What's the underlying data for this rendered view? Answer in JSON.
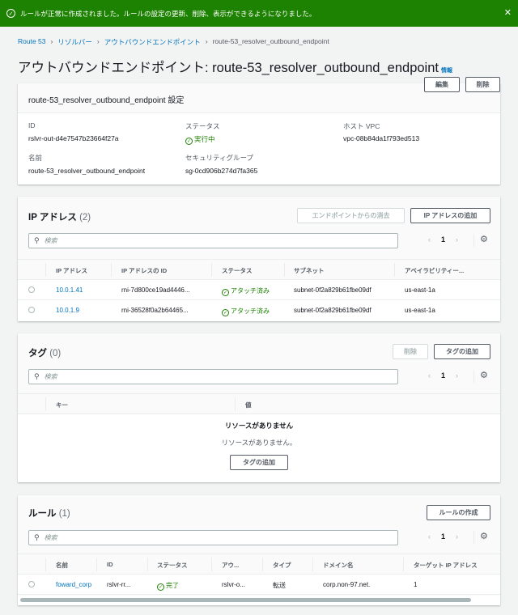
{
  "banner": {
    "message": "ルールが正常に作成されました。ルールの設定の更新、削除、表示ができるようになりました。",
    "success_color": "#1d8102"
  },
  "breadcrumb": [
    "Route 53",
    "リゾルバー",
    "アウトバウンドエンドポイント",
    "route-53_resolver_outbound_endpoint"
  ],
  "page": {
    "title": "アウトバウンドエンドポイント: route-53_resolver_outbound_endpoint",
    "info": "情報",
    "edit": "編集",
    "delete": "削除"
  },
  "settings": {
    "title": "route-53_resolver_outbound_endpoint 設定",
    "id_label": "ID",
    "id": "rslvr-out-d4e7547b23664f27a",
    "status_label": "ステータス",
    "status": "実行中",
    "vpc_label": "ホスト VPC",
    "vpc": "vpc-08b84da1f793ed513",
    "name_label": "名前",
    "name": "route-53_resolver_outbound_endpoint",
    "sg_label": "セキュリティグループ",
    "sg": "sg-0cd906b274d7fa365"
  },
  "ip": {
    "title": "IP アドレス",
    "count": "(2)",
    "remove": "エンドポイントからの消去",
    "add": "IP アドレスの追加",
    "search_placeholder": "検索",
    "page": "1",
    "columns": [
      "IP アドレス",
      "IP アドレスの ID",
      "ステータス",
      "サブネット",
      "アベイラビリティー..."
    ],
    "rows": [
      [
        "10.0.1.41",
        "rni-7d800ce19ad4446...",
        "アタッチ済み",
        "subnet-0f2a829b61fbe09df",
        "us-east-1a"
      ],
      [
        "10.0.1.9",
        "rni-36528f0a2b64465...",
        "アタッチ済み",
        "subnet-0f2a829b61fbe09df",
        "us-east-1a"
      ]
    ]
  },
  "tags": {
    "title": "タグ",
    "count": "(0)",
    "delete": "削除",
    "add": "タグの追加",
    "search_placeholder": "検索",
    "page": "1",
    "columns": [
      "キー",
      "値"
    ],
    "empty_title": "リソースがありません",
    "empty_text": "リソースがありません。",
    "empty_button": "タグの追加"
  },
  "rules": {
    "title": "ルール",
    "count": "(1)",
    "create": "ルールの作成",
    "search_placeholder": "検索",
    "page": "1",
    "columns": [
      "名前",
      "ID",
      "ステータス",
      "アウ...",
      "タイプ",
      "ドメイン名",
      "ターゲット IP アドレス"
    ],
    "rows": [
      [
        "foward_corp",
        "rslvr-rr...",
        "完了",
        "rslvr-o...",
        "転送",
        "corp.non-97.net.",
        "1"
      ]
    ]
  }
}
